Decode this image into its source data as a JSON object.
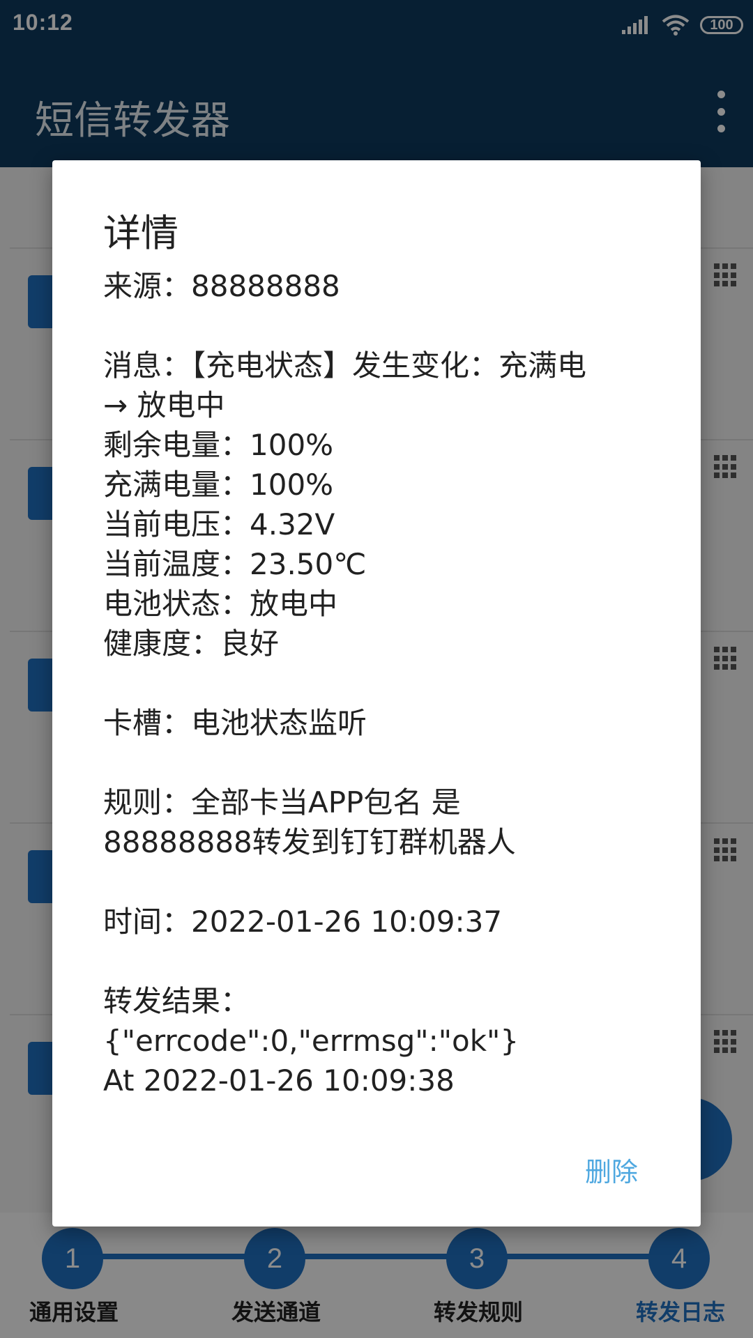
{
  "status_bar": {
    "time": "10:12",
    "battery": "100"
  },
  "app_bar": {
    "title": "短信转发器"
  },
  "dialog": {
    "title": "详情",
    "source": "来源：88888888",
    "message_lines": [
      "消息：【充电状态】发生变化：充满电",
      "→ 放电中",
      "剩余电量：100%",
      "充满电量：100%",
      "当前电压：4.32V",
      "当前温度：23.50℃",
      "电池状态：放电中",
      "健康度：良好"
    ],
    "slot": "卡槽：电池状态监听",
    "rule_lines": [
      "规则：全部卡当APP包名 是",
      "88888888转发到钉钉群机器人"
    ],
    "time": "时间：2022-01-26 10:09:37",
    "result_lines": [
      "转发结果：",
      "{\"errcode\":0,\"errmsg\":\"ok\"}",
      "At 2022-01-26 10:09:38"
    ],
    "delete_label": "删除"
  },
  "bottom_nav": {
    "steps": [
      {
        "number": "1",
        "label": "通用设置"
      },
      {
        "number": "2",
        "label": "发送通道"
      },
      {
        "number": "3",
        "label": "转发规则"
      },
      {
        "number": "4",
        "label": "转发日志"
      }
    ],
    "active_index": 3
  },
  "colors": {
    "primary": "#0e3a5e",
    "accent": "#1f6fbf",
    "button": "#4fa8e0"
  }
}
